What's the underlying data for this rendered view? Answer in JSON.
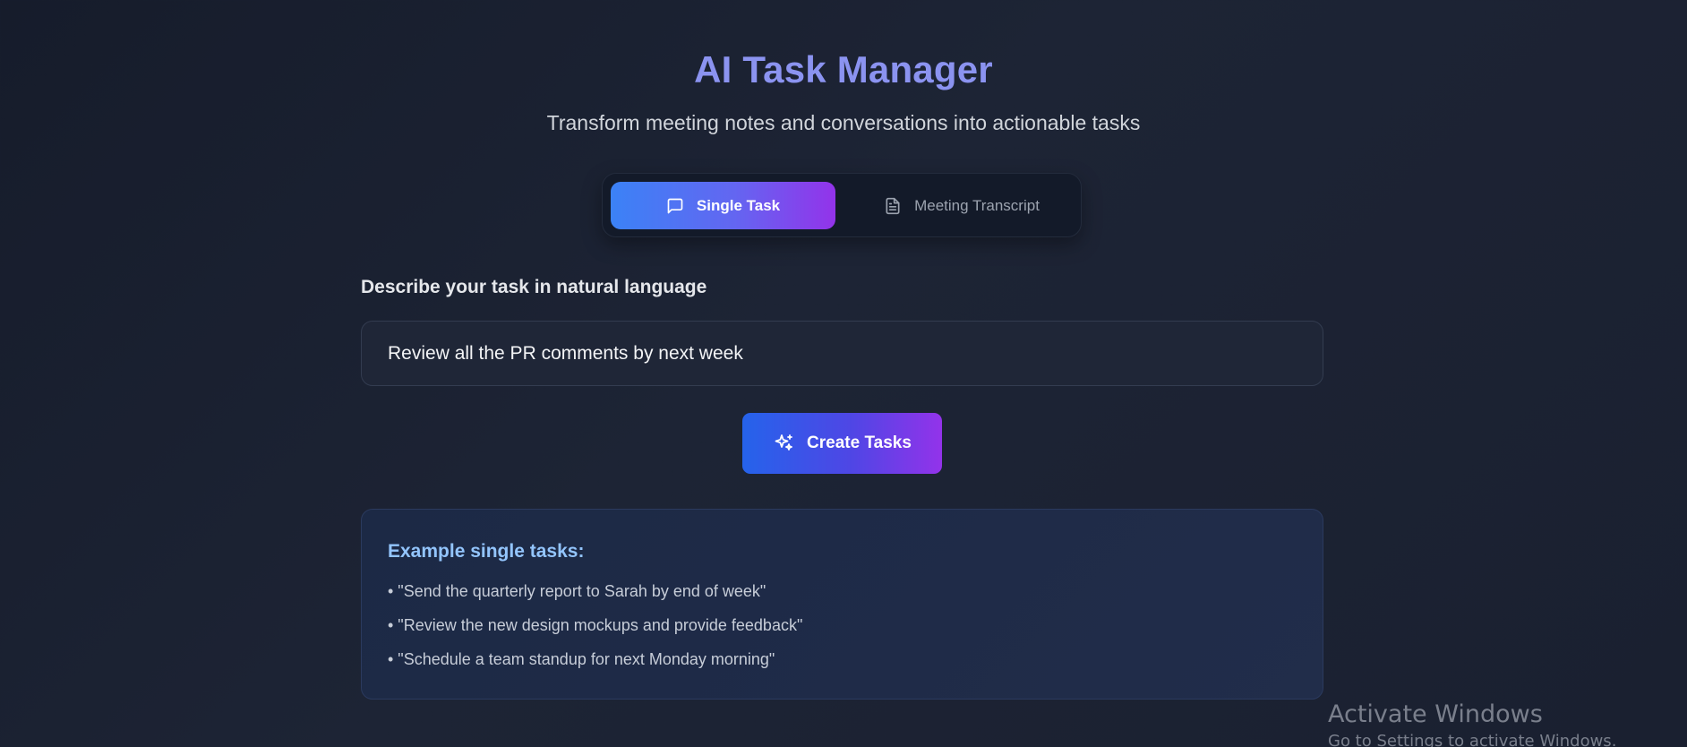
{
  "header": {
    "title": "AI Task Manager",
    "subtitle": "Transform meeting notes and conversations into actionable tasks"
  },
  "tabs": [
    {
      "label": "Single Task",
      "icon": "message-square-icon",
      "active": true
    },
    {
      "label": "Meeting Transcript",
      "icon": "document-icon",
      "active": false
    }
  ],
  "form": {
    "label": "Describe your task in natural language",
    "input_value": "Review all the PR comments by next week",
    "submit_label": "Create Tasks",
    "submit_icon": "sparkles-icon"
  },
  "examples": {
    "title": "Example single tasks:",
    "items": [
      "• \"Send the quarterly report to Sarah by end of week\"",
      "• \"Review the new design mockups and provide feedback\"",
      "• \"Schedule a team standup for next Monday morning\""
    ]
  },
  "watermark": {
    "title": "Activate Windows",
    "subtitle": "Go to Settings to activate Windows."
  },
  "colors": {
    "title": "#8b93f0",
    "accent_start": "#3b82f6",
    "accent_end": "#9333ea",
    "examples_title": "#93c5fd"
  }
}
